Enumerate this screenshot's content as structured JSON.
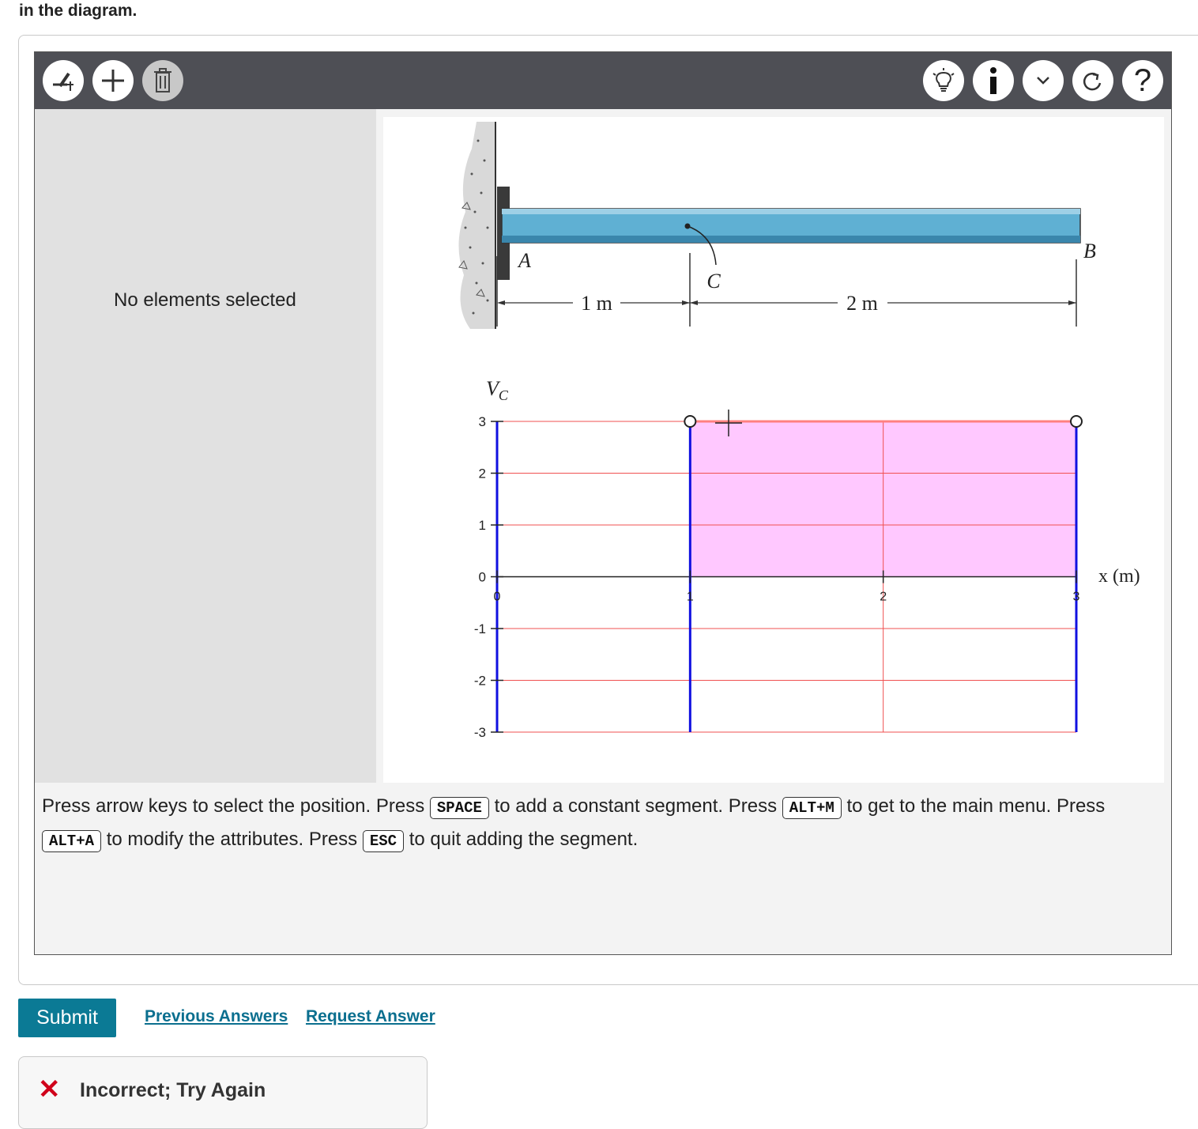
{
  "question": {
    "tail_text": "in the diagram."
  },
  "toolbar": {
    "left_buttons": [
      {
        "name": "add-segment-icon"
      },
      {
        "name": "plus-icon"
      },
      {
        "name": "trash-icon"
      }
    ],
    "right_buttons": [
      {
        "name": "lightbulb-icon"
      },
      {
        "name": "info-icon"
      },
      {
        "name": "chevron-down-icon"
      },
      {
        "name": "redo-icon"
      },
      {
        "name": "help-icon",
        "label": "?"
      }
    ]
  },
  "left_panel": {
    "status": "No elements selected"
  },
  "figure": {
    "labels": {
      "A": "A",
      "B": "B",
      "C": "C"
    },
    "dims": [
      "1 m",
      "2 m"
    ]
  },
  "chart_data": {
    "type": "area",
    "ylabel": "V",
    "ylabel_sub": "C",
    "xlabel": "x (m)",
    "xlim": [
      0,
      3
    ],
    "ylim": [
      -3,
      3
    ],
    "yticks": [
      "3",
      "2",
      "1",
      "0",
      "-1",
      "-2",
      "-3"
    ],
    "xticks": [
      "0",
      "1",
      "2",
      "3"
    ],
    "grid": true,
    "segments": [
      {
        "x_start": 1,
        "x_end": 3,
        "value": 3
      }
    ],
    "colors": {
      "fill": "#ffc8ff",
      "segment": "#ff8080",
      "boundary": "#1010e0",
      "grid": "#f05050"
    }
  },
  "hint": {
    "t1": "Press arrow keys to select the position. Press",
    "k1": "SPACE",
    "t2": "to add a constant segment. Press",
    "k2": "ALT+M",
    "t3": "to get to the main menu. Press",
    "k3": "ALT+A",
    "t4": "to modify the attributes. Press",
    "k4": "ESC",
    "t5": "to quit adding the segment."
  },
  "actions": {
    "submit": "Submit",
    "previous": "Previous Answers",
    "request": "Request Answer"
  },
  "feedback": {
    "icon": "✕",
    "text": "Incorrect; Try Again"
  }
}
